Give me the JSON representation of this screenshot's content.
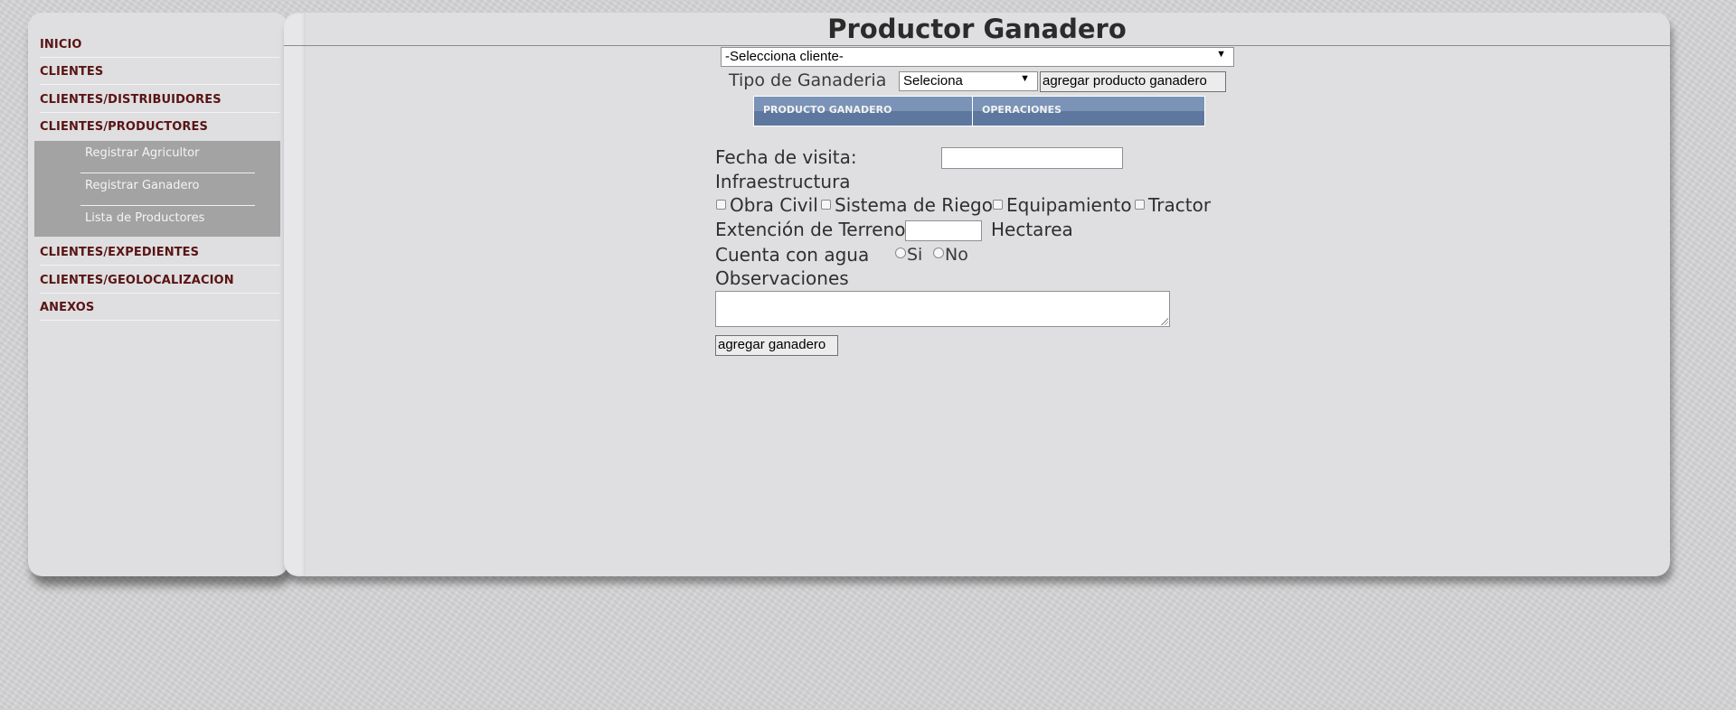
{
  "sidebar": {
    "items": [
      {
        "label": "INICIO"
      },
      {
        "label": "CLIENTES"
      },
      {
        "label": "CLIENTES/DISTRIBUIDORES"
      },
      {
        "label": "CLIENTES/PRODUCTORES"
      },
      {
        "label": "CLIENTES/EXPEDIENTES"
      },
      {
        "label": "CLIENTES/GEOLOCALIZACION"
      },
      {
        "label": "ANEXOS"
      }
    ],
    "submenu": [
      {
        "label": "Registrar Agricultor"
      },
      {
        "label": "Registrar Ganadero"
      },
      {
        "label": "Lista de Productores"
      }
    ]
  },
  "main": {
    "title": "Productor Ganadero",
    "client_select": {
      "value": "-Selecciona cliente-"
    },
    "tipo_label": "Tipo de Ganaderia",
    "tipo_select": {
      "value": "Seleciona"
    },
    "add_producto_button": "agregar producto ganadero",
    "producto_table": {
      "headers": [
        "PRODUCTO GANADERO",
        "OPERACIONES"
      ]
    },
    "form": {
      "fecha_label": "Fecha de visita:",
      "fecha_value": "",
      "infraestructura_label": "Infraestructura",
      "checkboxes": [
        {
          "label": "Obra Civil",
          "checked": false
        },
        {
          "label": "Sistema de Riego",
          "checked": false
        },
        {
          "label": "Equipamiento",
          "checked": false
        },
        {
          "label": "Tractor",
          "checked": false
        }
      ],
      "extension_label": "Extención de Terreno",
      "extension_value": "",
      "hectarea_label": "Hectarea",
      "agua_label": "Cuenta con agua",
      "agua_options": [
        {
          "label": "Si",
          "selected": false
        },
        {
          "label": "No",
          "selected": false
        }
      ],
      "observaciones_label": "Observaciones",
      "observaciones_value": "",
      "submit_button": "agregar ganadero"
    }
  },
  "colors": {
    "menu_text": "#5a1414",
    "submenu_bg": "#a3a3a3",
    "table_header_top": "#7a93b7",
    "table_header_bottom": "#5d779e",
    "panel_bg": "#dfdfe1"
  }
}
